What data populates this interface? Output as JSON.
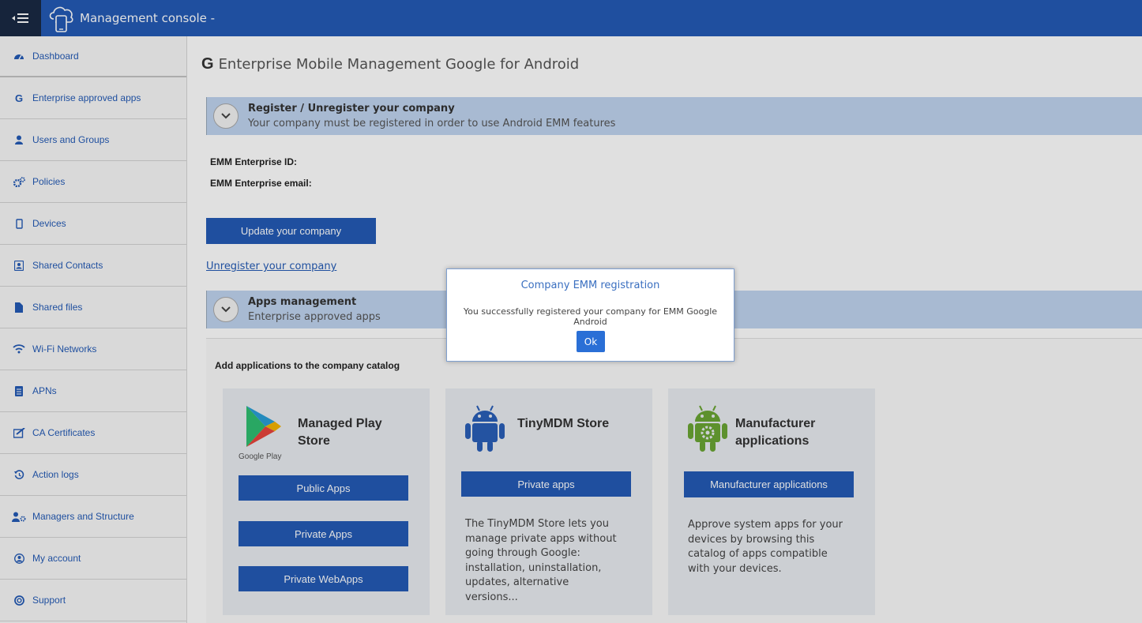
{
  "header": {
    "title": "Management console -",
    "menu_icon": "menu-collapse-icon",
    "logo_icon": "cloud-device-icon",
    "bar_color": "#245bb6"
  },
  "sidebar": {
    "items": [
      {
        "label": "Dashboard",
        "icon": "dashboard-icon"
      },
      {
        "label": "Enterprise approved apps",
        "icon": "google-icon"
      },
      {
        "label": "Users and Groups",
        "icon": "user-icon"
      },
      {
        "label": "Policies",
        "icon": "cogs-icon"
      },
      {
        "label": "Devices",
        "icon": "mobile-icon"
      },
      {
        "label": "Shared Contacts",
        "icon": "contact-book-icon"
      },
      {
        "label": "Shared files",
        "icon": "file-icon"
      },
      {
        "label": "Wi-Fi Networks",
        "icon": "wifi-icon"
      },
      {
        "label": "APNs",
        "icon": "apn-doc-icon"
      },
      {
        "label": "CA Certificates",
        "icon": "certificate-icon"
      },
      {
        "label": "Action logs",
        "icon": "history-icon"
      },
      {
        "label": "Managers and Structure",
        "icon": "user-cog-icon"
      },
      {
        "label": "My account",
        "icon": "account-circle-icon"
      },
      {
        "label": "Support",
        "icon": "lifebuoy-icon"
      }
    ]
  },
  "main": {
    "page_title_letter": "G",
    "page_title": "Enterprise Mobile Management Google for Android",
    "register_section": {
      "title": "Register / Unregister your company",
      "subtitle": "Your company must be registered in order to use Android EMM features"
    },
    "enterprise_id_label": "EMM Enterprise ID:",
    "enterprise_email_label": "EMM Enterprise email:",
    "update_button": "Update your company",
    "unregister_link": "Unregister your company",
    "apps_section": {
      "title": "Apps management",
      "subtitle": "Enterprise approved apps"
    },
    "catalog_label": "Add applications to the company catalog",
    "cards": {
      "play": {
        "title_line1": "Managed Play",
        "title_line2": "Store",
        "logo_caption": "Google Play",
        "buttons": [
          "Public Apps",
          "Private Apps",
          "Private WebApps"
        ]
      },
      "tinymdm": {
        "title": "TinyMDM Store",
        "button": "Private apps",
        "description": "The TinyMDM Store lets you manage private apps without going through Google: installation, uninstallation, updates, alternative versions..."
      },
      "manufacturer": {
        "title_line1": "Manufacturer",
        "title_line2": "applications",
        "button": "Manufacturer applications",
        "description": "Approve system apps for your devices by browsing this catalog of apps compatible with your devices."
      }
    }
  },
  "modal": {
    "title": "Company EMM registration",
    "message": "You successfully registered your company for EMM Google Android",
    "ok_label": "Ok"
  }
}
